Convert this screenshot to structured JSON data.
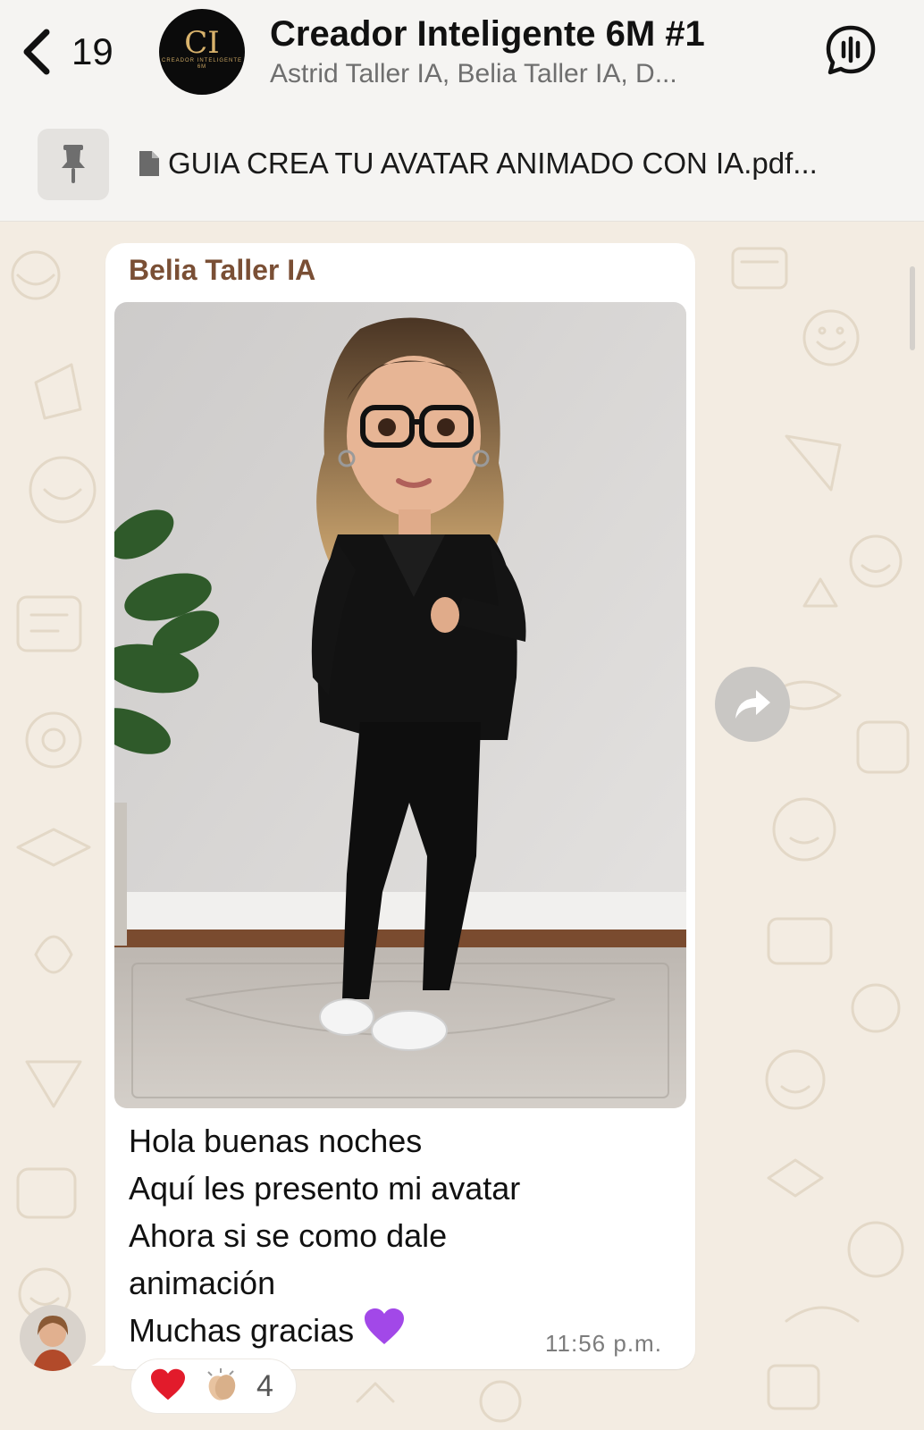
{
  "header": {
    "back_count": "19",
    "title": "Creador Inteligente 6M #1",
    "members": "Astrid Taller IA, Belia Taller IA, D...",
    "avatar_initials": "CI",
    "avatar_subtitle": "CREADOR INTELIGENTE",
    "avatar_tag": "6M",
    "icons": [
      "chevron-left-icon",
      "voice-chat-icon"
    ]
  },
  "pinned": {
    "label": "GUIA CREA TU AVATAR ANIMADO CON IA.pdf...",
    "icons": [
      "pin-icon",
      "document-icon"
    ]
  },
  "message": {
    "sender": "Belia Taller IA",
    "lines": [
      "Hola buenas noches",
      "Aquí les presento mi avatar",
      "Ahora si se como dale",
      "animación",
      "Muchas gracias"
    ],
    "time": "11:56 p.m.",
    "reactions": {
      "emojis": [
        "red-heart",
        "clapping-hands"
      ],
      "count": "4"
    }
  },
  "colors": {
    "chat_background": "#f3ece2",
    "header_background": "#f5f4f2",
    "sender_name": "#7a4f35",
    "bubble": "#ffffff"
  }
}
